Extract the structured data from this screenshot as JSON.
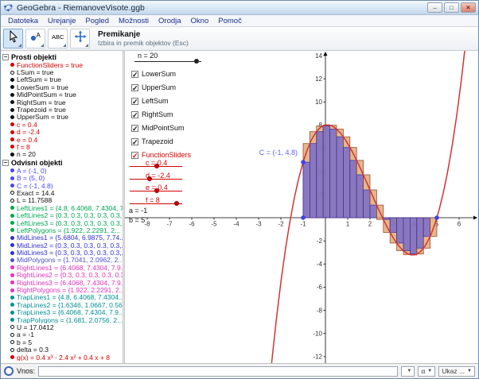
{
  "window": {
    "title": "GeoGebra - RiemanoveVisote.ggb",
    "controls": {
      "minimize": "–",
      "maximize": "□",
      "close": "✕"
    }
  },
  "menu": {
    "items": [
      "Datoteka",
      "Urejanje",
      "Pogled",
      "Možnosti",
      "Orodja",
      "Okno",
      "Pomoč"
    ]
  },
  "toolbar": {
    "mode_title": "Premikanje",
    "mode_subtitle": "Izbira in premik objektov (Esc)"
  },
  "algebra": {
    "free_header": "Prosti objekti",
    "dependent_header": "Odvisni objekti",
    "free": [
      {
        "label": "FunctionSliders = true",
        "color": "#d40000",
        "filled": true
      },
      {
        "label": "LSum = true",
        "color": "#111111",
        "filled": false
      },
      {
        "label": "LeftSum = true",
        "color": "#111111",
        "filled": true
      },
      {
        "label": "LowerSum = true",
        "color": "#111111",
        "filled": true
      },
      {
        "label": "MidPointSum = true",
        "color": "#111111",
        "filled": true
      },
      {
        "label": "RightSum = true",
        "color": "#111111",
        "filled": true
      },
      {
        "label": "Trapezoid = true",
        "color": "#111111",
        "filled": true
      },
      {
        "label": "UpperSum = true",
        "color": "#111111",
        "filled": true
      },
      {
        "label": "c = 0.4",
        "color": "#d40000",
        "filled": true
      },
      {
        "label": "d = -2.4",
        "color": "#d40000",
        "filled": true
      },
      {
        "label": "e = 0.4",
        "color": "#d40000",
        "filled": true
      },
      {
        "label": "f = 8",
        "color": "#d40000",
        "filled": true
      },
      {
        "label": "n = 20",
        "color": "#111111",
        "filled": true
      }
    ],
    "dependent": [
      {
        "label": "A = (-1, 0)",
        "color": "#4545ff",
        "filled": true
      },
      {
        "label": "B = (5, 0)",
        "color": "#4545ff",
        "filled": true
      },
      {
        "label": "C = (-1, 4.8)",
        "color": "#4545ff",
        "filled": true
      },
      {
        "label": "Exact = 14.4",
        "color": "#111111",
        "filled": false
      },
      {
        "label": "L = 11.7588",
        "color": "#111111",
        "filled": false
      },
      {
        "label": "LeftLines1 = {4.8, 6.4068, 7.4304, 7...",
        "color": "#00a651",
        "filled": true
      },
      {
        "label": "LeftLines2 = {0.3, 0.3, 0.3, 0.3, 0.3,...",
        "color": "#00a651",
        "filled": true
      },
      {
        "label": "LeftLines3 = {0.3, 0.3, 0.3, 0.3, 0.3,...",
        "color": "#00a651",
        "filled": true
      },
      {
        "label": "LeftPolygons = {1.922, 2.2291, 2...",
        "color": "#00a651",
        "filled": true
      },
      {
        "label": "MidLines1 = {5.6804, 6.9875, 7.74...",
        "color": "#3030d0",
        "filled": true
      },
      {
        "label": "MidLines2 = {0.3, 0.3, 0.3, 0.3, 0.3,...",
        "color": "#3030d0",
        "filled": true
      },
      {
        "label": "MidLines3 = {0.3, 0.3, 0.3, 0.3, 0.3,...",
        "color": "#3030d0",
        "filled": true
      },
      {
        "label": "MidPolygons = {1.7041, 2.0962, 2...",
        "color": "#5050c8",
        "filled": true
      },
      {
        "label": "RightLines1 = {6.4068, 7.4304, 7.9...",
        "color": "#e033b8",
        "filled": true
      },
      {
        "label": "RightLines2 = {0.3, 0.3, 0.3, 0.3, 0.3...",
        "color": "#e033b8",
        "filled": true
      },
      {
        "label": "RightLines3 = {6.4068, 7.4304, 7.9...",
        "color": "#e033b8",
        "filled": true
      },
      {
        "label": "RightPolygons = {1.922, 2.2291, 2...",
        "color": "#e033b8",
        "filled": true
      },
      {
        "label": "TrapLines1 = {4.8, 6.4068, 7.4304...",
        "color": "#009090",
        "filled": true
      },
      {
        "label": "TrapLines2 = {1.6346, 1.0667, 0.56...",
        "color": "#009090",
        "filled": true
      },
      {
        "label": "TrapLines3 = {6.4068, 7.4304, 7.9...",
        "color": "#009090",
        "filled": true
      },
      {
        "label": "TrapPolygons = {1.681, 2.0756, 2...",
        "color": "#009090",
        "filled": true
      },
      {
        "label": "U = 17.0412",
        "color": "#111111",
        "filled": false
      },
      {
        "label": "a = -1",
        "color": "#111111",
        "filled": false
      },
      {
        "label": "b = 5",
        "color": "#111111",
        "filled": false
      },
      {
        "label": "delta = 0.3",
        "color": "#111111",
        "filled": false
      },
      {
        "label": "g(x) = 0.4 x³ - 2.4 x² + 0.4 x + 8",
        "color": "#d40000",
        "filled": true
      }
    ]
  },
  "graphics": {
    "n_slider": {
      "label": "n = 20",
      "pos": 0.93
    },
    "checkboxes": [
      {
        "label": "LowerSum",
        "color": "#111111"
      },
      {
        "label": "UpperSum",
        "color": "#111111"
      },
      {
        "label": "LeftSum",
        "color": "#111111"
      },
      {
        "label": "RightSum",
        "color": "#111111"
      },
      {
        "label": "MidPointSum",
        "color": "#111111"
      },
      {
        "label": "Trapezoid",
        "color": "#111111"
      },
      {
        "label": "FunctionSliders",
        "color": "#d40000"
      }
    ],
    "sliders": [
      {
        "label": "c = 0.4",
        "pos": 0.52
      },
      {
        "label": "d = -2.4",
        "pos": 0.38
      },
      {
        "label": "e = 0.4",
        "pos": 0.52
      },
      {
        "label": "f = 8",
        "pos": 0.9
      }
    ],
    "labels": {
      "a": "a = -1",
      "b": "b = 5"
    }
  },
  "input_bar": {
    "label": "Vnos:",
    "greek": "α",
    "command": "Ukaz ..."
  },
  "chart_data": {
    "type": "function-plot",
    "function_label": "g(x) = 0.4 x³ - 2.4 x² + 0.4 x + 8",
    "coefficients": [
      0.4,
      -2.4,
      0.4,
      8
    ],
    "a": -1,
    "b": 5,
    "n": 20,
    "delta": 0.3,
    "exact_area": 14.4,
    "lower_sum": 11.7588,
    "upper_sum": 17.0412,
    "x_range": [
      -9,
      6.86
    ],
    "y_range": [
      -12.56,
      14.42
    ],
    "x_ticks": [
      -8,
      -7,
      -6,
      -5,
      -4,
      -3,
      -2,
      -1,
      1,
      2,
      3,
      4,
      5,
      6
    ],
    "y_ticks": [
      -12,
      -10,
      -8,
      -6,
      -4,
      -2,
      2,
      4,
      6,
      8,
      10,
      12,
      14
    ],
    "points": [
      {
        "label": "A",
        "x": -1,
        "y": 0
      },
      {
        "label": "B",
        "x": 5,
        "y": 0
      },
      {
        "label": "C",
        "x": -1,
        "y": 4.8
      }
    ],
    "point_label": "C = (-1, 4.8)",
    "curve_color": "#d43333",
    "upper_fill": "rgba(216,160,104,0.75)",
    "upper_stroke": "rgba(150,60,30,0.9)",
    "lower_fill": "rgba(122,108,200,0.85)",
    "lower_stroke": "rgba(60,50,160,0.9)",
    "grid": false
  }
}
